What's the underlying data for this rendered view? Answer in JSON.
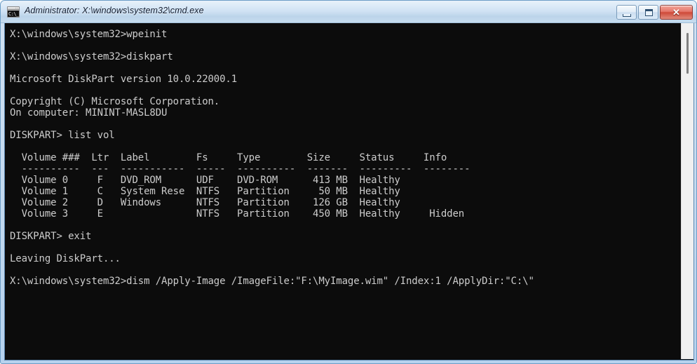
{
  "window": {
    "title": "Administrator: X:\\windows\\system32\\cmd.exe",
    "icon_name": "cmd-console-icon",
    "icon_glyph": "C:\\_",
    "icon_dots": "··",
    "frame_color": "#c3d9ef",
    "console_bg": "#0c0c0c",
    "console_fg": "#cccccc"
  },
  "caption_buttons": {
    "minimize_label": "Minimize",
    "maximize_label": "Maximize",
    "close_label": "Close",
    "close_glyph": "✕",
    "close_color": "#cf4a39"
  },
  "scrollbar": {
    "track_color": "#f0f0f0",
    "thumb_color": "#808080"
  },
  "console": {
    "lines": [
      "X:\\windows\\system32>wpeinit",
      "",
      "X:\\windows\\system32>diskpart",
      "",
      "Microsoft DiskPart version 10.0.22000.1",
      "",
      "Copyright (C) Microsoft Corporation.",
      "On computer: MININT-MASL8DU",
      "",
      "DISKPART> list vol",
      "",
      "  Volume ###  Ltr  Label        Fs     Type        Size     Status     Info",
      "  ----------  ---  -----------  -----  ----------  -------  ---------  --------",
      "  Volume 0     F   DVD_ROM      UDF    DVD-ROM      413 MB  Healthy",
      "  Volume 1     C   System Rese  NTFS   Partition     50 MB  Healthy",
      "  Volume 2     D   Windows      NTFS   Partition    126 GB  Healthy",
      "  Volume 3     E                NTFS   Partition    450 MB  Healthy     Hidden",
      "",
      "DISKPART> exit",
      "",
      "Leaving DiskPart...",
      "",
      "X:\\windows\\system32>dism /Apply-Image /ImageFile:\"F:\\MyImage.wim\" /Index:1 /ApplyDir:\"C:\\\""
    ],
    "text": "X:\\windows\\system32>wpeinit\n\nX:\\windows\\system32>diskpart\n\nMicrosoft DiskPart version 10.0.22000.1\n\nCopyright (C) Microsoft Corporation.\nOn computer: MININT-MASL8DU\n\nDISKPART> list vol\n\n  Volume ###  Ltr  Label        Fs     Type        Size     Status     Info\n  ----------  ---  -----------  -----  ----------  -------  ---------  --------\n  Volume 0     F   DVD_ROM      UDF    DVD-ROM      413 MB  Healthy\n  Volume 1     C   System Rese  NTFS   Partition     50 MB  Healthy\n  Volume 2     D   Windows      NTFS   Partition    126 GB  Healthy\n  Volume 3     E                NTFS   Partition    450 MB  Healthy     Hidden\n\nDISKPART> exit\n\nLeaving DiskPart...\n\nX:\\windows\\system32>dism /Apply-Image /ImageFile:\"F:\\MyImage.wim\" /Index:1 /ApplyDir:\"C:\\\"",
    "volume_table": {
      "columns": [
        "Volume ###",
        "Ltr",
        "Label",
        "Fs",
        "Type",
        "Size",
        "Status",
        "Info"
      ],
      "rows": [
        [
          "Volume 0",
          "F",
          "DVD_ROM",
          "UDF",
          "DVD-ROM",
          "413 MB",
          "Healthy",
          ""
        ],
        [
          "Volume 1",
          "C",
          "System Rese",
          "NTFS",
          "Partition",
          "50 MB",
          "Healthy",
          ""
        ],
        [
          "Volume 2",
          "D",
          "Windows",
          "NTFS",
          "Partition",
          "126 GB",
          "Healthy",
          ""
        ],
        [
          "Volume 3",
          "E",
          "",
          "NTFS",
          "Partition",
          "450 MB",
          "Healthy",
          "Hidden"
        ]
      ]
    },
    "commands": [
      "wpeinit",
      "diskpart",
      "list vol",
      "exit",
      "dism /Apply-Image /ImageFile:\"F:\\MyImage.wim\" /Index:1 /ApplyDir:\"C:\\\""
    ],
    "prompt": "X:\\windows\\system32>",
    "diskpart_prompt": "DISKPART> ",
    "diskpart_version": "Microsoft DiskPart version 10.0.22000.1",
    "copyright": "Copyright (C) Microsoft Corporation.",
    "computer": "On computer: MININT-MASL8DU",
    "leaving": "Leaving DiskPart..."
  }
}
